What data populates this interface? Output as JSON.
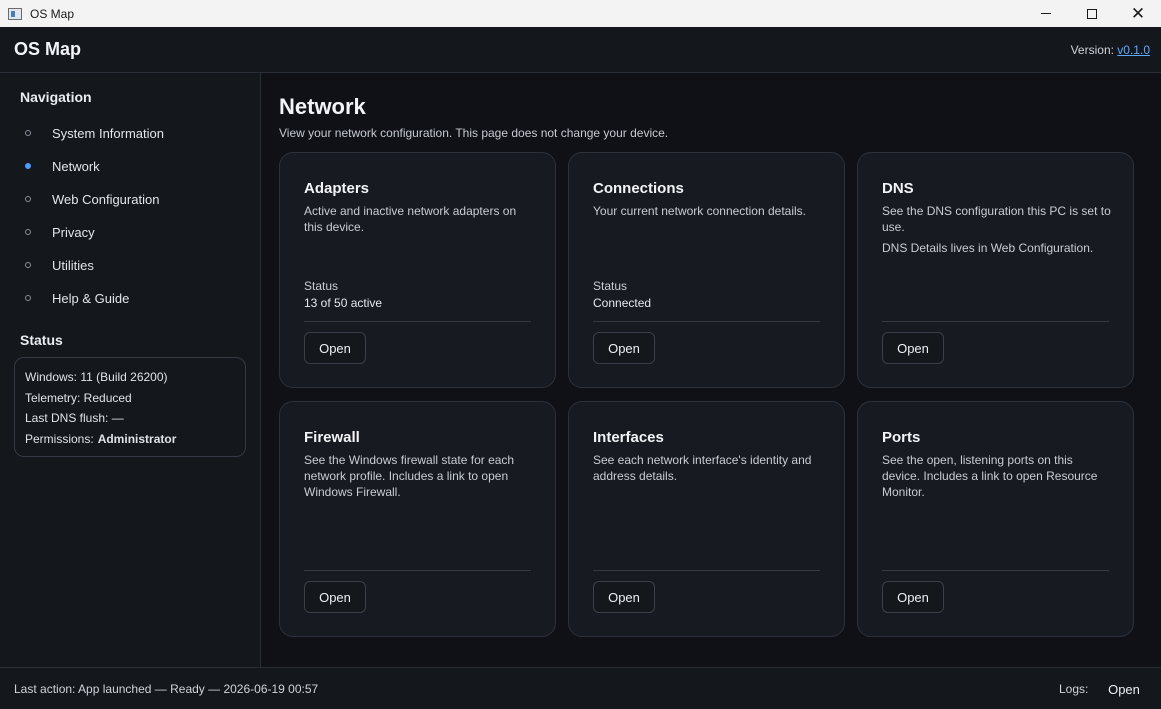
{
  "window": {
    "title": "OS Map",
    "icon": "app-window-icon",
    "controls": {
      "close_glyph": "✕"
    }
  },
  "header": {
    "app_title": "OS Map",
    "version_label": "Version:",
    "version_link": "v0.1.0",
    "link_color": "#5aa9ff"
  },
  "sidebar": {
    "nav_heading": "Navigation",
    "items": [
      {
        "label": "System Information",
        "active": false
      },
      {
        "label": "Network",
        "active": true
      },
      {
        "label": "Web Configuration",
        "active": false
      },
      {
        "label": "Privacy",
        "active": false
      },
      {
        "label": "Utilities",
        "active": false
      },
      {
        "label": "Help & Guide",
        "active": false
      }
    ],
    "active_color": "#4c9dff",
    "status_heading": "Status",
    "status": {
      "windows": "Windows: 11 (Build 26200)",
      "telemetry": "Telemetry: Reduced",
      "dns_flush": "Last DNS flush: —",
      "permissions_label": "Permissions:",
      "permissions_value": "Administrator"
    }
  },
  "main": {
    "title": "Network",
    "subtitle": "View your network configuration. This page does not change your device.",
    "cards": [
      {
        "title": "Adapters",
        "description": "Active and inactive network adapters on this device.",
        "status_label": "Status",
        "status_value": "13 of 50 active",
        "button": "Open"
      },
      {
        "title": "Connections",
        "description": "Your current network connection details.",
        "status_label": "Status",
        "status_value": "Connected",
        "button": "Open"
      },
      {
        "title": "DNS",
        "description": "See the DNS configuration this PC is set to use.",
        "note": "DNS Details lives in Web Configuration.",
        "button": "Open"
      },
      {
        "title": "Firewall",
        "description": "See the Windows firewall state for each network profile. Includes a link to open Windows Firewall.",
        "button": "Open"
      },
      {
        "title": "Interfaces",
        "description": "See each network interface's identity and address details.",
        "button": "Open"
      },
      {
        "title": "Ports",
        "description": "See the open, listening ports on this device. Includes a link to open Resource Monitor.",
        "button": "Open"
      }
    ]
  },
  "footer": {
    "last_action": "Last action: App launched — Ready — 2026-06-19 00:57",
    "logs_label": "Logs:",
    "logs_button": "Open"
  }
}
